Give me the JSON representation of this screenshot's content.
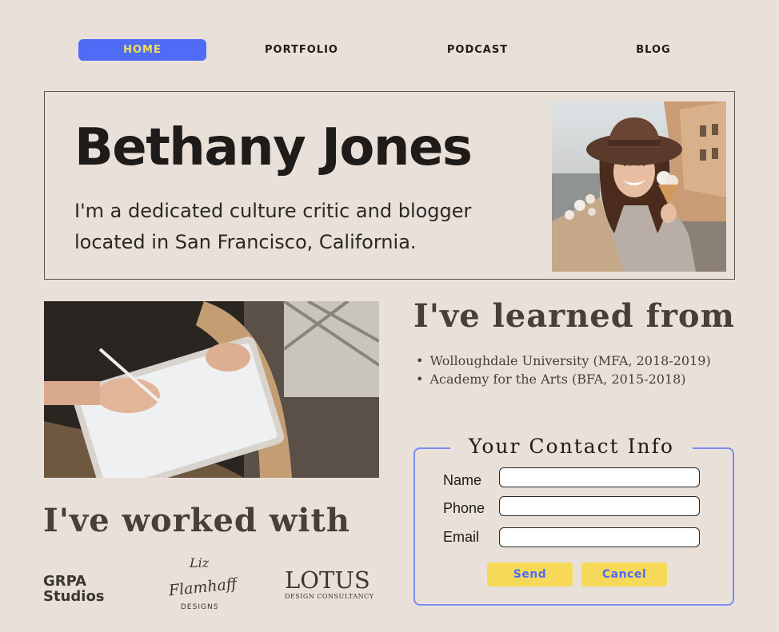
{
  "nav": {
    "items": [
      {
        "label": "HOME",
        "active": true
      },
      {
        "label": "PORTFOLIO",
        "active": false
      },
      {
        "label": "PODCAST",
        "active": false
      },
      {
        "label": "BLOG",
        "active": false
      }
    ]
  },
  "hero": {
    "name": "Bethany Jones",
    "tagline": "I'm a dedicated culture critic and blogger located in San Francisco, California."
  },
  "learned": {
    "heading": "I've learned from",
    "items": [
      "Wolloughdale University (MFA, 2018-2019)",
      "Academy for the Arts (BFA, 2015-2018)"
    ]
  },
  "worked": {
    "heading": "I've worked with",
    "logos": {
      "grpa_line1": "GRPA",
      "grpa_line2": "Studios",
      "liz_line1": "Liz",
      "liz_line2": "Flamhaff",
      "liz_line3": "DESIGNS",
      "lotus_main": "LOTUS",
      "lotus_sub": "DESIGN CONSULTANCY"
    }
  },
  "contact": {
    "title": "Your Contact Info",
    "fields": [
      {
        "label": "Name",
        "value": ""
      },
      {
        "label": "Phone",
        "value": ""
      },
      {
        "label": "Email",
        "value": ""
      }
    ],
    "send_label": "Send",
    "cancel_label": "Cancel"
  },
  "colors": {
    "background": "#e8e0d9",
    "accent_blue": "#4e6cf5",
    "accent_yellow": "#f7d95a",
    "text_dark": "#1e1b19",
    "heading_brown": "#4a3f36"
  }
}
